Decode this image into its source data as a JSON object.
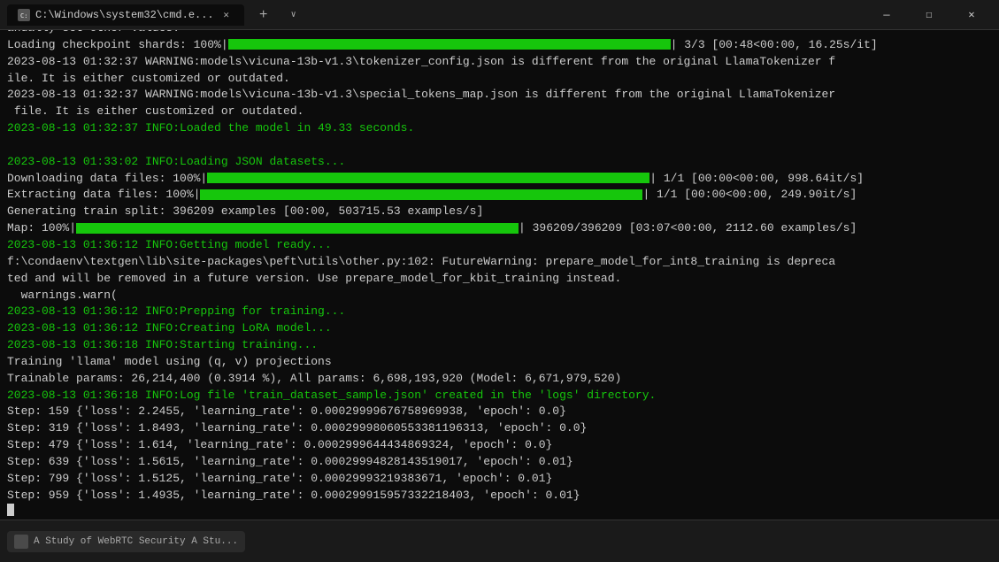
{
  "window": {
    "title": "C:\\Windows\\system32\\cmd.e...",
    "tab_label": "C:\\Windows\\system32\\cmd.e...",
    "controls": {
      "minimize": "—",
      "maximize": "☐",
      "close": "✕"
    },
    "add_tab": "+",
    "dropdown": "∨"
  },
  "terminal": {
    "lines": [
      {
        "id": 1,
        "text": "anually set other values.",
        "color": "white"
      },
      {
        "id": 2,
        "text": "Loading checkpoint shards: 100%|████████████████████████████████████████████████████████████| 3/3 [00:48<00:00, 16.25s/it]",
        "color": "white",
        "has_progress": true,
        "progress_pct": 100,
        "progress_label": "Loading checkpoint shards: 100%",
        "progress_suffix": " 3/3 [00:48<00:00, 16.25s/it]"
      },
      {
        "id": 3,
        "text": "2023-08-13 01:32:37 WARNING:models\\vicuna-13b-v1.3\\tokenizer_config.json is different from the original LlamaTokenizer f",
        "color": "white"
      },
      {
        "id": 4,
        "text": "ile. It is either customized or outdated.",
        "color": "white"
      },
      {
        "id": 5,
        "text": "2023-08-13 01:32:37 WARNING:models\\vicuna-13b-v1.3\\special_tokens_map.json is different from the original LlamaTokenizer",
        "color": "white"
      },
      {
        "id": 6,
        "text": " file. It is either customized or outdated.",
        "color": "white"
      },
      {
        "id": 7,
        "text": "2023-08-13 01:32:37 INFO:Loaded the model in 49.33 seconds.",
        "color": "green"
      },
      {
        "id": 8,
        "text": "",
        "color": "white"
      },
      {
        "id": 9,
        "text": "2023-08-13 01:33:02 INFO:Loading JSON datasets...",
        "color": "green"
      },
      {
        "id": 10,
        "text": "Downloading data files: 100%|████████████████████████████████████████████████████████████| 1/1 [00:00<00:00, 998.64it/s]",
        "color": "white",
        "has_progress": true
      },
      {
        "id": 11,
        "text": "Extracting data files: 100%|████████████████████████████████████████████████████████████| 1/1 [00:00<00:00, 249.90it/s]",
        "color": "white",
        "has_progress": true
      },
      {
        "id": 12,
        "text": "Generating train split: 396209 examples [00:00, 503715.53 examples/s]",
        "color": "white"
      },
      {
        "id": 13,
        "text": "Map: 100%|████████████████████████████████████████████████████████████| 396209/396209 [03:07<00:00, 2112.60 examples/s]",
        "color": "white",
        "has_progress": true
      },
      {
        "id": 14,
        "text": "2023-08-13 01:36:12 INFO:Getting model ready...",
        "color": "green"
      },
      {
        "id": 15,
        "text": "f:\\condaenv\\textgen\\lib\\site-packages\\peft\\utils\\other.py:102: FutureWarning: prepare_model_for_int8_training is depreca",
        "color": "white"
      },
      {
        "id": 16,
        "text": "ted and will be removed in a future version. Use prepare_model_for_kbit_training instead.",
        "color": "white"
      },
      {
        "id": 17,
        "text": "  warnings.warn(",
        "color": "white"
      },
      {
        "id": 18,
        "text": "2023-08-13 01:36:12 INFO:Prepping for training...",
        "color": "green"
      },
      {
        "id": 19,
        "text": "2023-08-13 01:36:12 INFO:Creating LoRA model...",
        "color": "green"
      },
      {
        "id": 20,
        "text": "2023-08-13 01:36:18 INFO:Starting training...",
        "color": "green"
      },
      {
        "id": 21,
        "text": "Training 'llama' model using (q, v) projections",
        "color": "white"
      },
      {
        "id": 22,
        "text": "Trainable params: 26,214,400 (0.3914 %), All params: 6,698,193,920 (Model: 6,671,979,520)",
        "color": "white"
      },
      {
        "id": 23,
        "text": "2023-08-13 01:36:18 INFO:Log file 'train_dataset_sample.json' created in the 'logs' directory.",
        "color": "green"
      },
      {
        "id": 24,
        "text": "Step: 159 {'loss': 2.2455, 'learning_rate': 0.00029999676758969938, 'epoch': 0.0}",
        "color": "white"
      },
      {
        "id": 25,
        "text": "Step: 319 {'loss': 1.8493, 'learning_rate': 0.00029998060553381196313, 'epoch': 0.0}",
        "color": "white"
      },
      {
        "id": 26,
        "text": "Step: 479 {'loss': 1.614, 'learning_rate': 0.0002999644434869324, 'epoch': 0.0}",
        "color": "white"
      },
      {
        "id": 27,
        "text": "Step: 639 {'loss': 1.5615, 'learning_rate': 0.00029994828143519017, 'epoch': 0.01}",
        "color": "white"
      },
      {
        "id": 28,
        "text": "Step: 799 {'loss': 1.5125, 'learning_rate': 0.00029993219383671, 'epoch': 0.01}",
        "color": "white"
      },
      {
        "id": 29,
        "text": "Step: 959 {'loss': 1.4935, 'learning_rate': 0.000299915957332218403, 'epoch': 0.01}",
        "color": "white"
      }
    ]
  },
  "taskbar": {
    "item_label": "A Study of WebRTC Security A Stu..."
  }
}
